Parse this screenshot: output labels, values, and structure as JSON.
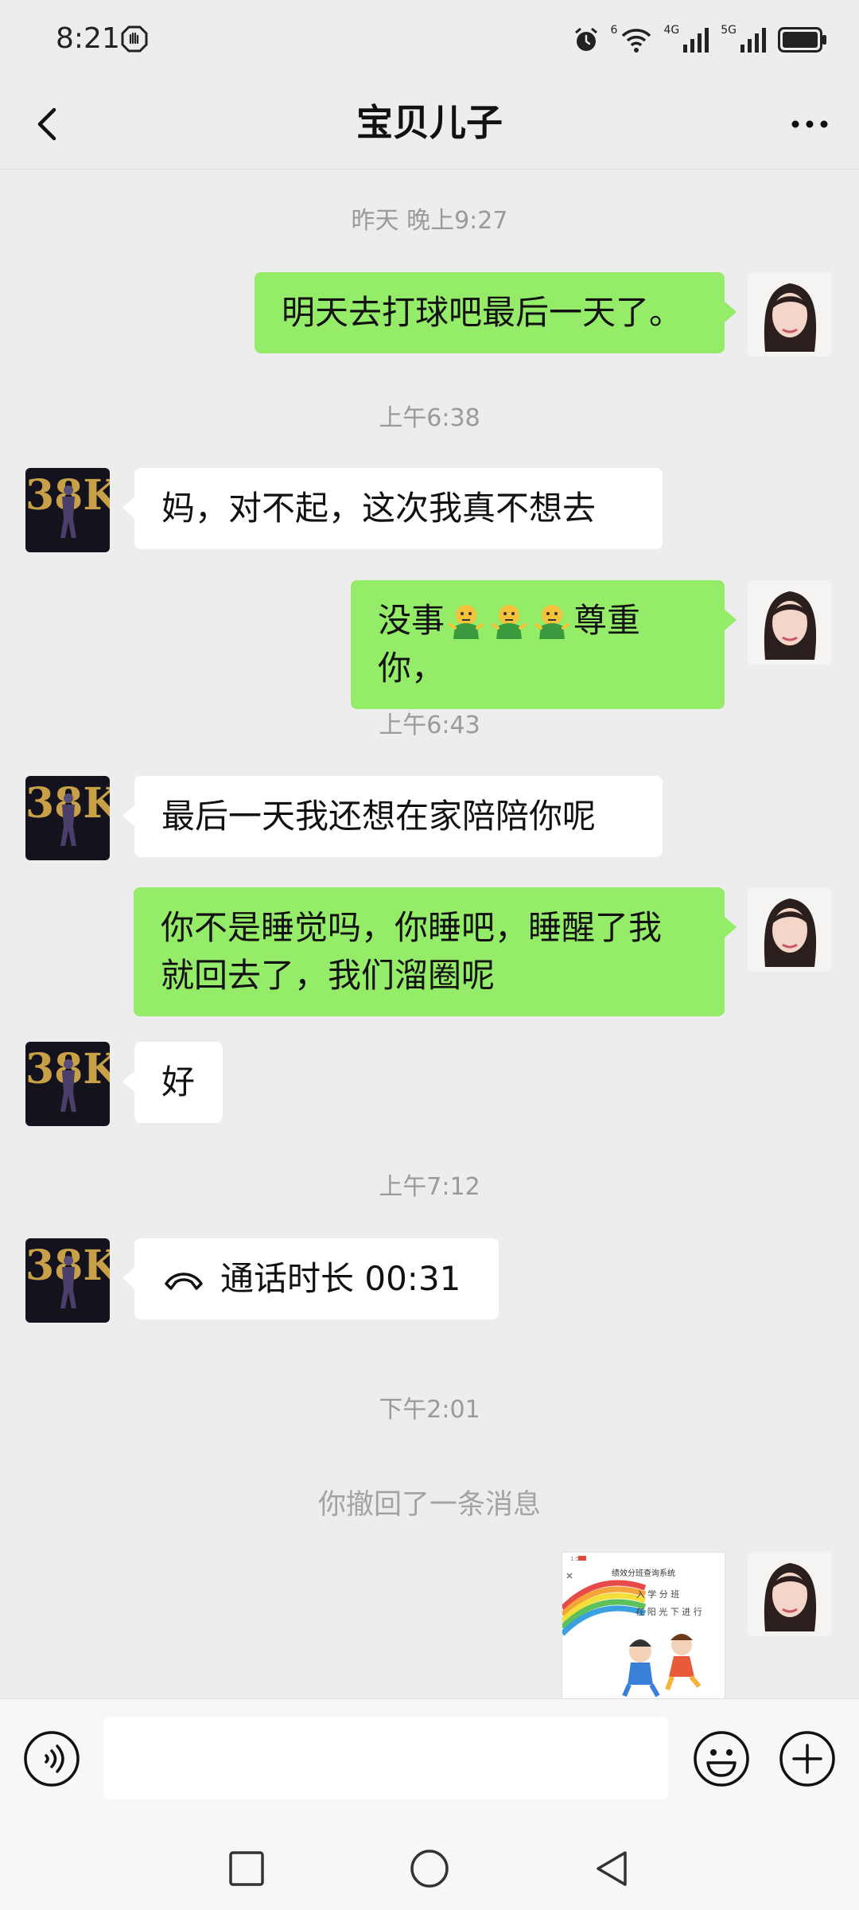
{
  "status_bar": {
    "time": "8:21",
    "net1": "6",
    "net2": "4G",
    "net3": "5G"
  },
  "header": {
    "title": "宝贝儿子"
  },
  "avatars": {
    "son_text": "38K"
  },
  "messages": {
    "ts1": "昨天 晚上9:27",
    "m1": "明天去打球吧最后一天了。",
    "ts2": "上午6:38",
    "m2": "妈，对不起，这次我真不想去",
    "m3_a": "没事",
    "m3_b": "尊重你，",
    "ts3": "上午6:43",
    "m4": "最后一天我还想在家陪陪你呢",
    "m5_line1": "你不是睡觉吗，你睡吧，睡醒了我",
    "m5_line2": "就回去了，我们溜圈呢",
    "m6": "好",
    "ts4": "上午7:12",
    "m7_call": "通话时长 00:31",
    "ts5": "下午2:01",
    "recall": "你撤回了一条消息"
  },
  "image_message": {
    "status": "1:58",
    "title": "绩效分班查询系统",
    "line1": "入 学 分 班",
    "line2": "在 阳 光 下 进 行"
  },
  "colors": {
    "outgoing_bubble": "#95ec69",
    "incoming_bubble": "#ffffff",
    "background": "#ededed"
  }
}
